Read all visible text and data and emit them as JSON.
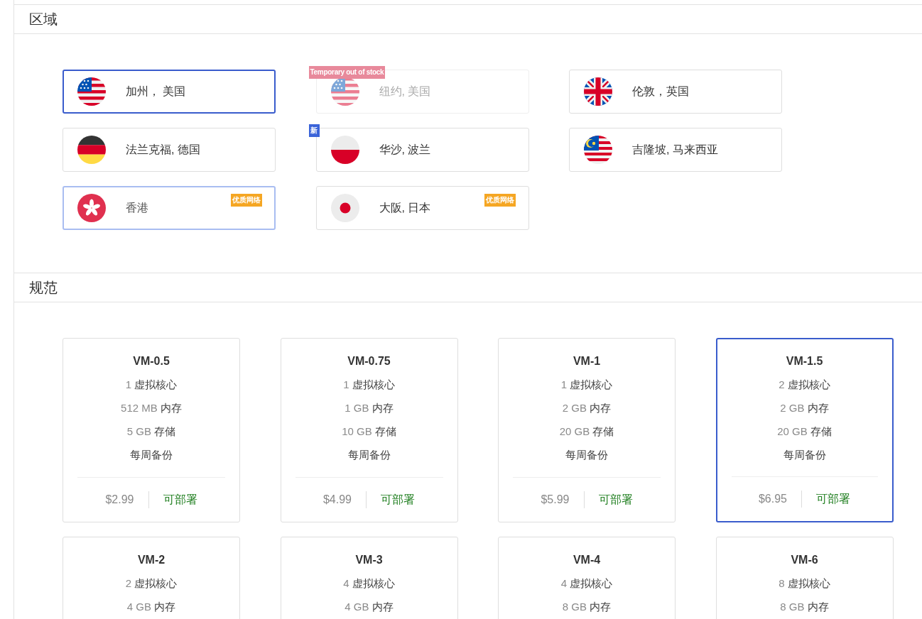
{
  "region_section": {
    "title": "区域",
    "regions": [
      {
        "name": "加州， 美国",
        "kind": "us",
        "selected": true,
        "hovered": false,
        "disabled": false
      },
      {
        "name": "纽约, 美国",
        "kind": "us",
        "selected": false,
        "hovered": false,
        "disabled": true,
        "badge": {
          "kind": "stock",
          "text": "Temporary out of stock"
        }
      },
      {
        "name": "伦敦，英国",
        "kind": "uk",
        "selected": false,
        "hovered": false,
        "disabled": false
      },
      {
        "name": "法兰克福, 德国",
        "kind": "de",
        "selected": false,
        "hovered": false,
        "disabled": false
      },
      {
        "name": "华沙, 波兰",
        "kind": "pl",
        "selected": false,
        "hovered": false,
        "disabled": false,
        "badge": {
          "kind": "new",
          "text": "新"
        }
      },
      {
        "name": "吉隆坡, 马来西亚",
        "kind": "my",
        "selected": false,
        "hovered": false,
        "disabled": false
      },
      {
        "name": "香港",
        "kind": "hk",
        "selected": false,
        "hovered": true,
        "disabled": false,
        "badge": {
          "kind": "premium",
          "text": "优质网络"
        }
      },
      {
        "name": "大阪, 日本",
        "kind": "jp",
        "selected": false,
        "hovered": false,
        "disabled": false,
        "badge": {
          "kind": "premium",
          "text": "优质网络"
        }
      }
    ]
  },
  "spec_section": {
    "title": "规范",
    "plans": [
      {
        "name": "VM-0.5",
        "selected": false,
        "specs": [
          {
            "value": "1",
            "unit": "虚拟核心"
          },
          {
            "value": "512 MB",
            "unit": "内存"
          },
          {
            "value": "5 GB",
            "unit": "存储"
          },
          {
            "unit": "每周备份"
          }
        ],
        "price": "$2.99",
        "status": "可部署"
      },
      {
        "name": "VM-0.75",
        "selected": false,
        "specs": [
          {
            "value": "1",
            "unit": "虚拟核心"
          },
          {
            "value": "1 GB",
            "unit": "内存"
          },
          {
            "value": "10 GB",
            "unit": "存储"
          },
          {
            "unit": "每周备份"
          }
        ],
        "price": "$4.99",
        "status": "可部署"
      },
      {
        "name": "VM-1",
        "selected": false,
        "specs": [
          {
            "value": "1",
            "unit": "虚拟核心"
          },
          {
            "value": "2 GB",
            "unit": "内存"
          },
          {
            "value": "20 GB",
            "unit": "存储"
          },
          {
            "unit": "每周备份"
          }
        ],
        "price": "$5.99",
        "status": "可部署"
      },
      {
        "name": "VM-1.5",
        "selected": true,
        "specs": [
          {
            "value": "2",
            "unit": "虚拟核心"
          },
          {
            "value": "2 GB",
            "unit": "内存"
          },
          {
            "value": "20 GB",
            "unit": "存储"
          },
          {
            "unit": "每周备份"
          }
        ],
        "price": "$6.95",
        "status": "可部署"
      },
      {
        "name": "VM-2",
        "selected": false,
        "specs": [
          {
            "value": "2",
            "unit": "虚拟核心"
          },
          {
            "value": "4 GB",
            "unit": "内存"
          }
        ]
      },
      {
        "name": "VM-3",
        "selected": false,
        "specs": [
          {
            "value": "4",
            "unit": "虚拟核心"
          },
          {
            "value": "4 GB",
            "unit": "内存"
          }
        ]
      },
      {
        "name": "VM-4",
        "selected": false,
        "specs": [
          {
            "value": "4",
            "unit": "虚拟核心"
          },
          {
            "value": "8 GB",
            "unit": "内存"
          }
        ]
      },
      {
        "name": "VM-6",
        "selected": false,
        "specs": [
          {
            "value": "8",
            "unit": "虚拟核心"
          },
          {
            "value": "8 GB",
            "unit": "内存"
          }
        ]
      }
    ]
  }
}
